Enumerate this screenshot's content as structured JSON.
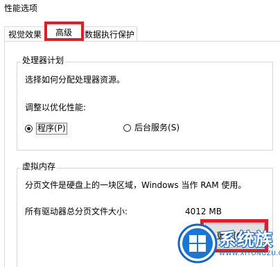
{
  "window": {
    "title": "性能选项"
  },
  "tabs": [
    {
      "label": "视觉效果",
      "selected": false
    },
    {
      "label": "高级",
      "selected": true
    },
    {
      "label": "数据执行保护",
      "selected": false
    }
  ],
  "processor_scheduling": {
    "legend": "处理器计划",
    "description": "选择如何分配处理器资源。",
    "adjust_label": "调整以优化性能:",
    "options": [
      {
        "label": "程序",
        "accel": "(P)",
        "checked": true
      },
      {
        "label": "后台服务",
        "accel": "(S)",
        "checked": false
      }
    ]
  },
  "virtual_memory": {
    "legend": "虚拟内存",
    "description": "分页文件是硬盘上的一块区域，Windows 当作 RAM 使用。",
    "total_label": "所有驱动器总分页文件大小:",
    "total_value": "4012 MB",
    "change_button": "更改(C)..."
  },
  "watermark": {
    "name": "系统族",
    "url": "WWW.XITONGZU.COM"
  },
  "colors": {
    "highlight": "#e01e26",
    "logo_blue": "#1565c0"
  }
}
